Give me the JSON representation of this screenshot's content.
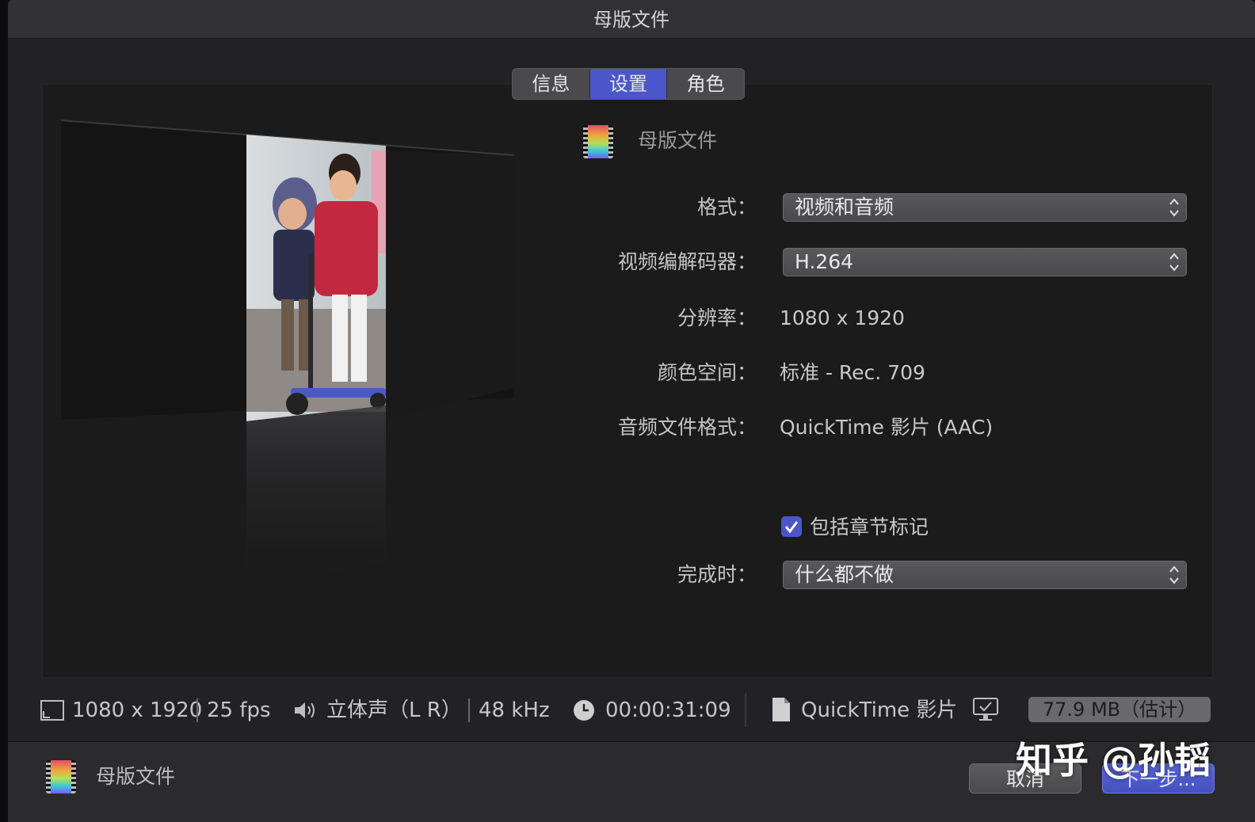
{
  "window": {
    "title": "母版文件"
  },
  "tabs": [
    {
      "label": "信息",
      "active": false
    },
    {
      "label": "设置",
      "active": true
    },
    {
      "label": "角色",
      "active": false
    }
  ],
  "header": {
    "label": "母版文件",
    "icon": "film-icon"
  },
  "settings": {
    "format": {
      "label": "格式：",
      "value": "视频和音频"
    },
    "codec": {
      "label": "视频编解码器：",
      "value": "H.264"
    },
    "resolution": {
      "label": "分辨率：",
      "value": "1080 x 1920"
    },
    "color_space": {
      "label": "颜色空间：",
      "value": "标准 - Rec. 709"
    },
    "audio_format": {
      "label": "音频文件格式：",
      "value": "QuickTime 影片 (AAC)"
    },
    "chapter_markers": {
      "label": "包括章节标记",
      "checked": true
    },
    "on_complete": {
      "label": "完成时：",
      "value": "什么都不做"
    }
  },
  "status_bar": {
    "resolution": "1080 x 1920",
    "fps": "25 fps",
    "audio_channels": "立体声（L R）",
    "sample_rate": "48 kHz",
    "duration": "00:00:31:09",
    "file_type": "QuickTime 影片",
    "size": "77.9 MB（估计）"
  },
  "footer": {
    "label": "母版文件",
    "cancel_label": "取消",
    "next_label": "下一步..."
  },
  "watermark": "知乎 @孙韬",
  "colors": {
    "accent": "#4b57c8",
    "window_bg": "#222224",
    "panel_bg": "#1b1b1c"
  }
}
